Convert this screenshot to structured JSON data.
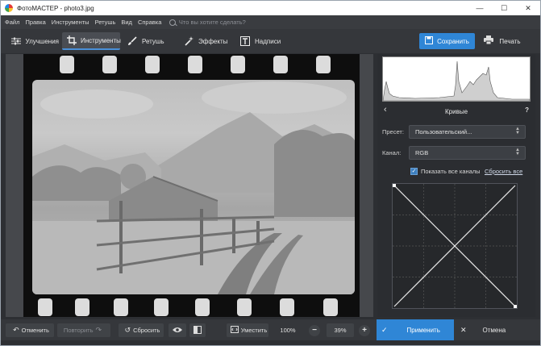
{
  "window": {
    "title": "ФотоМАСТЕР - photo3.jpg",
    "controls": {
      "minimize": "—",
      "maximize": "☐",
      "close": "✕"
    }
  },
  "menu": {
    "items": [
      "Файл",
      "Правка",
      "Инструменты",
      "Ретушь",
      "Вид",
      "Справка"
    ],
    "search_placeholder": "Что вы хотите сделать?"
  },
  "toolbar": {
    "tabs": [
      {
        "label": "Улучшения",
        "icon": "sliders-icon",
        "active": false
      },
      {
        "label": "Инструменты",
        "icon": "crop-icon",
        "active": true
      },
      {
        "label": "Ретушь",
        "icon": "brush-icon",
        "active": false
      },
      {
        "label": "Эффекты",
        "icon": "magic-wand-icon",
        "active": false
      },
      {
        "label": "Надписи",
        "icon": "text-icon",
        "active": false
      }
    ],
    "save_label": "Сохранить",
    "print_label": "Печать"
  },
  "panel": {
    "title": "Кривые",
    "help": "?",
    "preset_label": "Пресет:",
    "preset_value": "Пользовательский...",
    "channel_label": "Канал:",
    "channel_value": "RGB",
    "show_all_channels_label": "Показать все каналы",
    "show_all_channels_checked": true,
    "reset_all_label": "Сбросить все"
  },
  "bottom": {
    "undo_label": "Отменить",
    "redo_label": "Повторить",
    "reset_label": "Сбросить",
    "fit_label": "Уместить",
    "zoom_100_label": "100%",
    "zoom_value": "39%",
    "zoom_out": "−",
    "zoom_in": "+",
    "apply_label": "Применить",
    "cancel_label": "Отмена"
  },
  "colors": {
    "accent": "#2f86d6",
    "background": "#2d2f33"
  }
}
